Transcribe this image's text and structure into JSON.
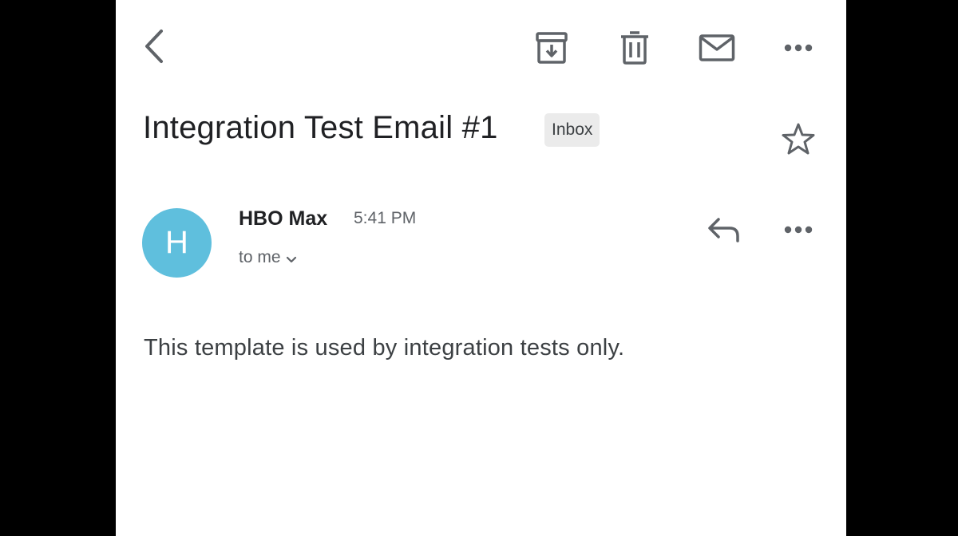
{
  "toolbar": {
    "back_icon": "chevron-left-icon",
    "archive_icon": "archive-icon",
    "delete_icon": "trash-icon",
    "mark_unread_icon": "envelope-icon",
    "more_icon": "more-horizontal-icon"
  },
  "email": {
    "subject": "Integration Test Email #1",
    "label": "Inbox",
    "starred": false,
    "star_icon": "star-outline-icon",
    "sender": {
      "name": "HBO Max",
      "initial": "H",
      "avatar_color": "#5fbfdd"
    },
    "time": "5:41 PM",
    "recipient": "to me",
    "reply_icon": "reply-icon",
    "message_more_icon": "more-horizontal-icon",
    "body": "This template is used by integration tests only."
  }
}
